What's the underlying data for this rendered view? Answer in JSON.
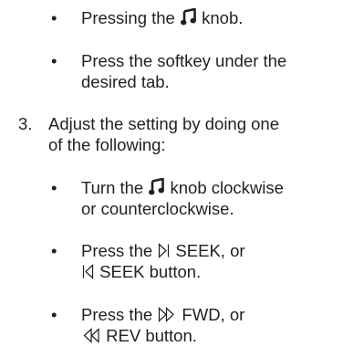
{
  "items": [
    {
      "bullet": "•",
      "lines": [
        "Pressing the ",
        " knob."
      ]
    },
    {
      "bullet": "•",
      "lines": [
        "Press the softkey under the",
        "desired tab."
      ]
    },
    {
      "number": "3.",
      "lines": [
        "Adjust the setting by doing one",
        "of the following:"
      ]
    },
    {
      "bullet": "•",
      "lines": [
        "Turn the ",
        " knob clockwise",
        "or counterclockwise."
      ]
    },
    {
      "bullet": "•",
      "lines": [
        "Press the ",
        " SEEK, or",
        " SEEK button."
      ]
    },
    {
      "bullet": "•",
      "lines": [
        "Press the ",
        " FWD, or",
        " REV button."
      ]
    }
  ],
  "icons": {
    "tune_knob": "music-note-icon",
    "seek_next": "seek-next-icon",
    "seek_prev": "seek-prev-icon",
    "fwd": "fast-forward-icon",
    "rev": "rewind-icon"
  },
  "colors": {
    "text": "#231f20"
  }
}
